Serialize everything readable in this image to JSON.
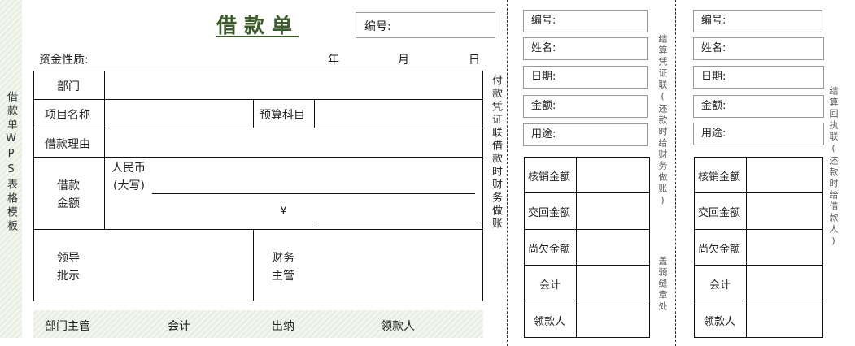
{
  "side_strip": {
    "label": "借款单WPS表格模板"
  },
  "form": {
    "title": "借款单",
    "serial_label": "编号:",
    "fund_nature_label": "资金性质:",
    "date_year": "年",
    "date_month": "月",
    "date_day": "日",
    "rows": {
      "department": "部门",
      "project_name": "项目名称",
      "budget_subject": "预算科目",
      "loan_reason": "借款理由",
      "loan_amount_1": "借款",
      "loan_amount_2": "金额",
      "rmb": "人民币",
      "capital": "(大写)",
      "yen": "¥",
      "leader_1": "领导",
      "leader_2": "批示",
      "finance_1": "财务",
      "finance_2": "主管"
    },
    "footer": {
      "dept_head": "部门主管",
      "accountant": "会计",
      "cashier": "出纳",
      "receiver": "领款人"
    },
    "side_note": "付款凭证联借款时财务做账"
  },
  "stub1": {
    "fields": [
      "编号:",
      "姓名:",
      "日期:",
      "金额:",
      "用途:"
    ],
    "table": [
      "核销金额",
      "交回金额",
      "尚欠金额",
      "会计",
      "领款人"
    ],
    "note_top": "结算凭证联(还款时给财务做账)",
    "note_bottom": "盖骑缝章处"
  },
  "stub2": {
    "fields": [
      "编号:",
      "姓名:",
      "日期:",
      "金额:",
      "用途:"
    ],
    "table": [
      "核销金额",
      "交回金额",
      "尚欠金额",
      "会计",
      "领款人"
    ],
    "note_top": "结算回执联(还款时给借款人)"
  },
  "colors": {
    "accent": "#3b5e2b",
    "hatch": "#e9efe2"
  }
}
